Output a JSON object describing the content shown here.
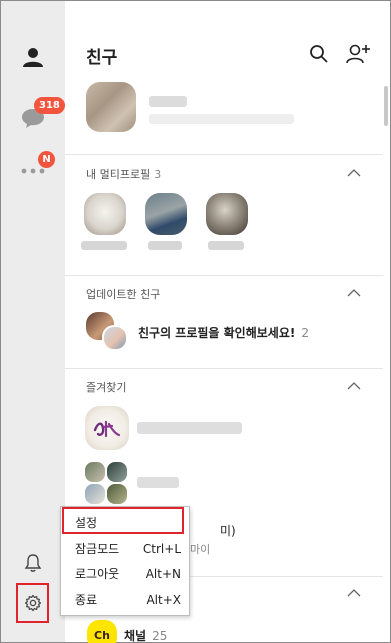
{
  "sidebar": {
    "chat_badge": "318",
    "more_badge": "N"
  },
  "window": {
    "minimize": "—",
    "maximize": "☐",
    "close": "✕"
  },
  "header": {
    "title": "친구"
  },
  "sections": {
    "multiprofile": {
      "title": "내 멀티프로필",
      "count": "3"
    },
    "updated": {
      "title": "업데이트한 친구",
      "message": "친구의 프로필을 확인해보세요!",
      "count": "2"
    },
    "favorites": {
      "title": "즐겨찾기"
    }
  },
  "partial": {
    "text1": "미)",
    "text2": "마이",
    "channel_icon": "Ch",
    "channel_label": "채널",
    "channel_count": "25"
  },
  "menu": {
    "items": [
      {
        "label": "설정",
        "shortcut": ""
      },
      {
        "label": "잠금모드",
        "shortcut": "Ctrl+L"
      },
      {
        "label": "로그아웃",
        "shortcut": "Alt+N"
      },
      {
        "label": "종료",
        "shortcut": "Alt+X"
      }
    ]
  },
  "colors": {
    "accent_badge": "#f2543d",
    "highlight": "#e0242c",
    "channel": "#fee500"
  }
}
